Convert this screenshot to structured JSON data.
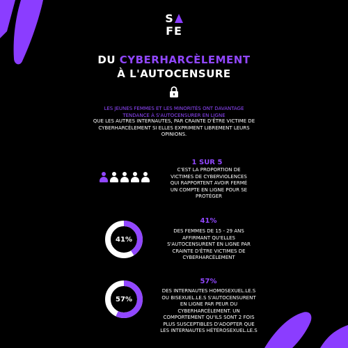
{
  "logo": {
    "line1": "S",
    "line2": "FE"
  },
  "title": {
    "line1_prefix": "DU ",
    "line1_highlight": "CYBERHARCÈLEMENT",
    "line2": "À L'AUTOCENSURE"
  },
  "intro": {
    "accent_text": "LES JEUNES FEMMES ET LES MINORITÉS ONT DAVANTAGE TENDANCE À S'AUTOCENSURER EN LIGNE",
    "body_text": "QUE LES AUTRES INTERNAUTES, PAR CRAINTE D'ÊTRE VICTIME DE CYBERHARCÈLEMENT SI ELLES EXPRIMENT LIBREMENT LEURS OPINIONS."
  },
  "stats": [
    {
      "value": "1 SUR 5",
      "text": "C'EST LA PROPORTION DE VICTIMES DE CYBERVIOLENCES QUI RAPPORTENT AVOIR FERMÉ UN COMPTE EN LIGNE POUR SE PROTÉGER",
      "icons_total": 5,
      "icons_highlighted": 1
    },
    {
      "value": "41%",
      "donut_label": "41%",
      "percent": 41,
      "text": "DES FEMMES DE 15 - 29 ANS AFFIRMANT QU'ELLES S'AUTOCENSURENT EN LIGNE PAR CRAINTE D'ÊTRE VICTIMES DE CYBERHARCÈLEMENT"
    },
    {
      "value": "57%",
      "donut_label": "57%",
      "percent": 57,
      "text": "DES INTERNAUTES HOMOSEXUEL.LE.S OU BISEXUEL.LE.S S'AUTOCENSURENT EN LIGNE PAR PEUR DU CYBERHARCÈLEMENT. UN COMPORTEMENT QU'ILS SONT 2 FOIS PLUS SUSCEPTIBLES D'ADOPTER QUE LES INTERNAUTES HÉTÉROSEXUEL.LE.S"
    }
  ],
  "colors": {
    "accent": "#9147ff",
    "background": "#000000",
    "text": "#ffffff"
  },
  "icons": [
    "lock-icon",
    "person-icon"
  ]
}
